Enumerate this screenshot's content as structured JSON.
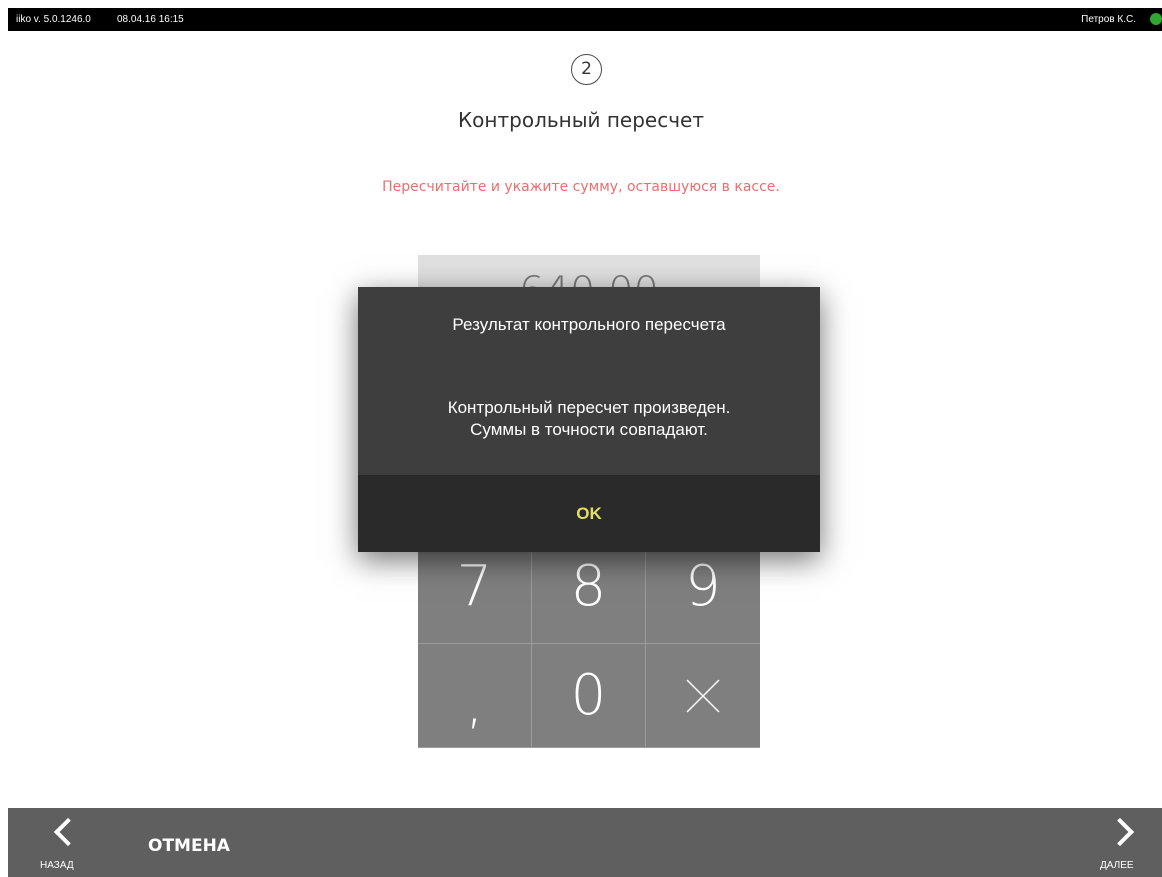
{
  "topbar": {
    "version": "iiko v. 5.0.1246.0",
    "datetime": "08.04.16  16:15",
    "user": "Петров К.С.",
    "status_color": "#2ea82e"
  },
  "wizard": {
    "step_number": "2",
    "title": "Контрольный пересчет",
    "hint": "Пересчитайте и укажите сумму, оставшуюся в кассе.",
    "hint_color": "#e86f6f",
    "amount": "640,00"
  },
  "keypad": {
    "keys": [
      "7",
      "8",
      "9",
      ",",
      "0",
      "×"
    ]
  },
  "dialog": {
    "title": "Результат контрольного пересчета",
    "message_line1": "Контрольный пересчет произведен.",
    "message_line2": "Суммы в точности совпадают.",
    "ok_label": "OK",
    "ok_color": "#e3e060"
  },
  "bottombar": {
    "back_label": "НАЗАД",
    "cancel_label": "ОТМЕНА",
    "next_label": "ДАЛЕЕ"
  }
}
